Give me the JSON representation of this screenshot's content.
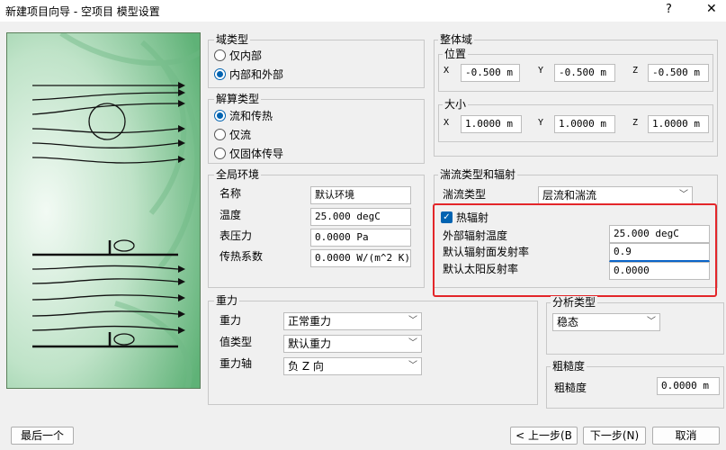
{
  "window": {
    "title": "新建项目向导 - 空项目 模型设置",
    "help": "?",
    "close": "✕"
  },
  "domain_type": {
    "label": "域类型",
    "options": [
      {
        "label": "仅内部",
        "checked": false
      },
      {
        "label": "内部和外部",
        "checked": true
      }
    ]
  },
  "solve_type": {
    "label": "解算类型",
    "options": [
      {
        "label": "流和传热",
        "checked": true
      },
      {
        "label": "仅流",
        "checked": false
      },
      {
        "label": "仅固体传导",
        "checked": false
      }
    ]
  },
  "global_env": {
    "label": "全局环境",
    "rows": [
      {
        "label": "名称",
        "value": "默认环境"
      },
      {
        "label": "温度",
        "value": "25.000 degC"
      },
      {
        "label": "表压力",
        "value": "0.0000 Pa"
      },
      {
        "label": "传热系数",
        "value": "0.0000 W/(m^2 K)"
      }
    ]
  },
  "gravity": {
    "label": "重力",
    "rows": [
      {
        "label": "重力",
        "value": "正常重力"
      },
      {
        "label": "值类型",
        "value": "默认重力"
      },
      {
        "label": "重力轴",
        "value": "负 Z 向"
      }
    ]
  },
  "overall_domain": {
    "label": "整体域",
    "position": {
      "label": "位置",
      "x_label": "X",
      "x": "-0.500 m",
      "y_label": "Y",
      "y": "-0.500 m",
      "z_label": "Z",
      "z": "-0.500 m"
    },
    "size": {
      "label": "大小",
      "x_label": "X",
      "x": "1.0000 m",
      "y_label": "Y",
      "y": "1.0000 m",
      "z_label": "Z",
      "z": "1.0000 m"
    }
  },
  "turbulence": {
    "label": "湍流类型和辐射",
    "type_label": "湍流类型",
    "type_value": "层流和湍流",
    "radiation_label": "热辐射",
    "radiation_checked": true,
    "ext_temp_label": "外部辐射温度",
    "ext_temp": "25.000 degC",
    "emissivity_label": "默认辐射面发射率",
    "emissivity": "0.9",
    "solar_label": "默认太阳反射率",
    "solar": "0.0000"
  },
  "analysis": {
    "label": "分析类型",
    "value": "稳态"
  },
  "roughness": {
    "label": "粗糙度",
    "field_label": "粗糙度",
    "value": "0.0000 m"
  },
  "buttons": {
    "last": "最后一个",
    "prev": "< 上一步(B",
    "next": "下一步(N)",
    "cancel": "取消"
  },
  "colors": {
    "accent": "#0063b1",
    "highlight": "#e3262a",
    "image_green": "#7fc490"
  }
}
